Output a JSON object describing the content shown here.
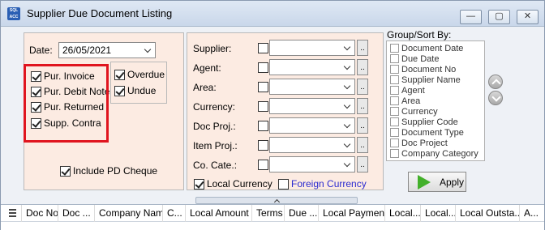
{
  "window": {
    "title": "Supplier Due Document Listing",
    "icon_text": [
      "SQL",
      "ACC"
    ],
    "minimize_symbol": "—",
    "maximize_symbol": "▢",
    "close_symbol": "✕"
  },
  "filters": {
    "date_label": "Date:",
    "date_value": "26/05/2021",
    "doc_types": [
      {
        "label": "Pur. Invoice",
        "checked": true
      },
      {
        "label": "Pur. Debit Note",
        "checked": true
      },
      {
        "label": "Pur. Returned",
        "checked": true
      },
      {
        "label": "Supp. Contra",
        "checked": true
      }
    ],
    "due_status": [
      {
        "label": "Overdue",
        "checked": true
      },
      {
        "label": "Undue",
        "checked": true
      }
    ],
    "include_pd_cheque": {
      "label": "Include PD Cheque",
      "checked": true
    }
  },
  "criteria": {
    "rows": [
      {
        "label": "Supplier:",
        "checked": false,
        "value": ""
      },
      {
        "label": "Agent:",
        "checked": false,
        "value": ""
      },
      {
        "label": "Area:",
        "checked": false,
        "value": ""
      },
      {
        "label": "Currency:",
        "checked": false,
        "value": ""
      },
      {
        "label": "Doc Proj.:",
        "checked": false,
        "value": ""
      },
      {
        "label": "Item Proj.:",
        "checked": false,
        "value": ""
      },
      {
        "label": "Co. Cate.:",
        "checked": false,
        "value": ""
      }
    ],
    "browse_label": "..",
    "local_currency": {
      "label": "Local Currency",
      "checked": true
    },
    "foreign_currency": {
      "label": "Foreign Currency",
      "checked": false
    },
    "colors": {
      "foreign_currency_text": "#2b2bd0"
    }
  },
  "group_sort": {
    "title": "Group/Sort By:",
    "items": [
      "Document Date",
      "Due Date",
      "Document No",
      "Supplier Name",
      "Agent",
      "Area",
      "Currency",
      "Supplier Code",
      "Document Type",
      "Doc Project",
      "Company Category"
    ],
    "move_up_icon": "arrow-up-icon",
    "move_down_icon": "arrow-down-icon"
  },
  "apply_button": {
    "label": "Apply",
    "icon": "play-icon"
  },
  "grid": {
    "columns": [
      "Doc No",
      "Doc ...",
      "Company Name",
      "C...",
      "Local Amount",
      "Terms",
      "Due ...",
      "Local Payment",
      "Local...",
      "Local...",
      "Local Outsta...",
      "A..."
    ]
  },
  "colors": {
    "panel_bg": "#fcebe2",
    "highlight_border": "#e0141e",
    "apply_icon": "#43b02a"
  }
}
